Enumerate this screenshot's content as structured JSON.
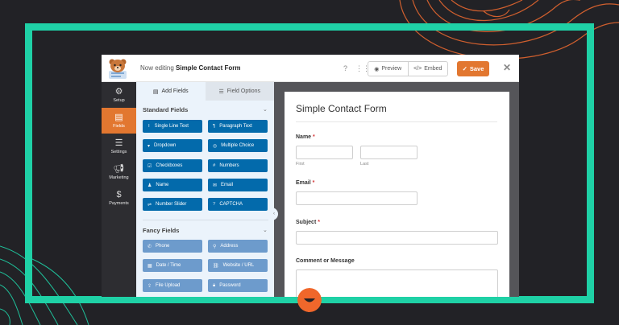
{
  "header": {
    "editing_prefix": "Now editing",
    "form_name": "Simple Contact Form",
    "preview_label": "Preview",
    "embed_label": "Embed",
    "save_label": "Save"
  },
  "sidebar": {
    "items": [
      {
        "label": "Setup",
        "icon": "gear-icon"
      },
      {
        "label": "Fields",
        "icon": "fields-icon",
        "active": true
      },
      {
        "label": "Settings",
        "icon": "sliders-icon"
      },
      {
        "label": "Marketing",
        "icon": "megaphone-icon"
      },
      {
        "label": "Payments",
        "icon": "dollar-icon"
      }
    ]
  },
  "panel": {
    "tabs": {
      "add_fields": "Add Fields",
      "field_options": "Field Options"
    },
    "standard": {
      "title": "Standard Fields",
      "fields": [
        "Single Line Text",
        "Paragraph Text",
        "Dropdown",
        "Multiple Choice",
        "Checkboxes",
        "Numbers",
        "Name",
        "Email",
        "Number Slider",
        "CAPTCHA"
      ]
    },
    "fancy": {
      "title": "Fancy Fields",
      "fields": [
        "Phone",
        "Address",
        "Date / Time",
        "Website / URL",
        "File Upload",
        "Password"
      ]
    }
  },
  "form": {
    "title": "Simple Contact Form",
    "name_label": "Name",
    "first_label": "First",
    "last_label": "Last",
    "email_label": "Email",
    "subject_label": "Subject",
    "message_label": "Comment or Message",
    "required_mark": "*"
  },
  "colors": {
    "accent": "#e27730",
    "frame": "#1fd1a6",
    "standard_button": "#036aab",
    "fancy_button": "#6d9bcc"
  }
}
